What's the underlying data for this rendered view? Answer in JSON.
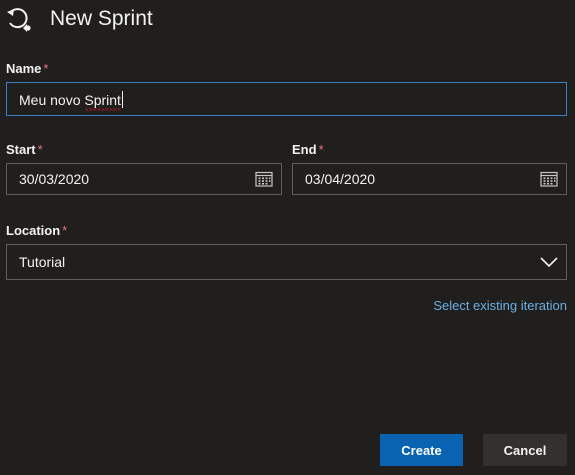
{
  "dialog": {
    "title": "New Sprint",
    "icon": "sprint-cycle-icon"
  },
  "form": {
    "name": {
      "label": "Name",
      "required_mark": "*",
      "value": "Meu novo Sprint"
    },
    "start": {
      "label": "Start",
      "required_mark": "*",
      "value": "30/03/2020",
      "icon": "calendar-icon"
    },
    "end": {
      "label": "End",
      "required_mark": "*",
      "value": "03/04/2020",
      "icon": "calendar-icon"
    },
    "location": {
      "label": "Location",
      "required_mark": "*",
      "value": "Tutorial",
      "icon": "chevron-down-icon"
    },
    "select_existing_link": "Select existing iteration"
  },
  "actions": {
    "create_label": "Create",
    "cancel_label": "Cancel"
  },
  "colors": {
    "background": "#201f1e",
    "accent": "#0a63b0",
    "link": "#69afe5",
    "required": "#f1707b",
    "focus_border": "#3b7fc4"
  }
}
